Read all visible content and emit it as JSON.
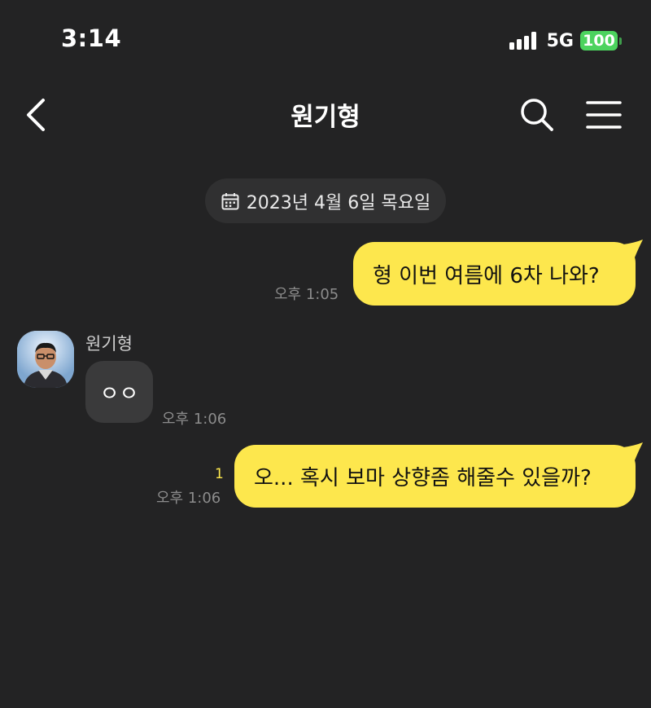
{
  "status_bar": {
    "time": "3:14",
    "network": "5G",
    "battery": "100",
    "battery_color": "#4cd35e"
  },
  "header": {
    "title": "원기형",
    "back_icon": "chevron-left-icon",
    "search_icon": "search-icon",
    "menu_icon": "hamburger-menu-icon"
  },
  "date_divider": {
    "icon": "calendar-icon",
    "text": "2023년 4월 6일 목요일"
  },
  "messages": [
    {
      "direction": "outgoing",
      "text": "형 이번 여름에 6차 나와?",
      "time": "오후 1:05"
    },
    {
      "direction": "incoming",
      "sender": "원기형",
      "text": "ㅇㅇ",
      "time": "오후 1:06"
    },
    {
      "direction": "outgoing",
      "text": "오... 혹시 보마 상향좀 해줄수 있을까?",
      "time": "오후 1:06",
      "unread_count": "1"
    }
  ],
  "colors": {
    "background": "#232324",
    "outgoing_bubble": "#fde74d",
    "incoming_bubble": "#3a3a3b",
    "unread": "#fde74d"
  }
}
